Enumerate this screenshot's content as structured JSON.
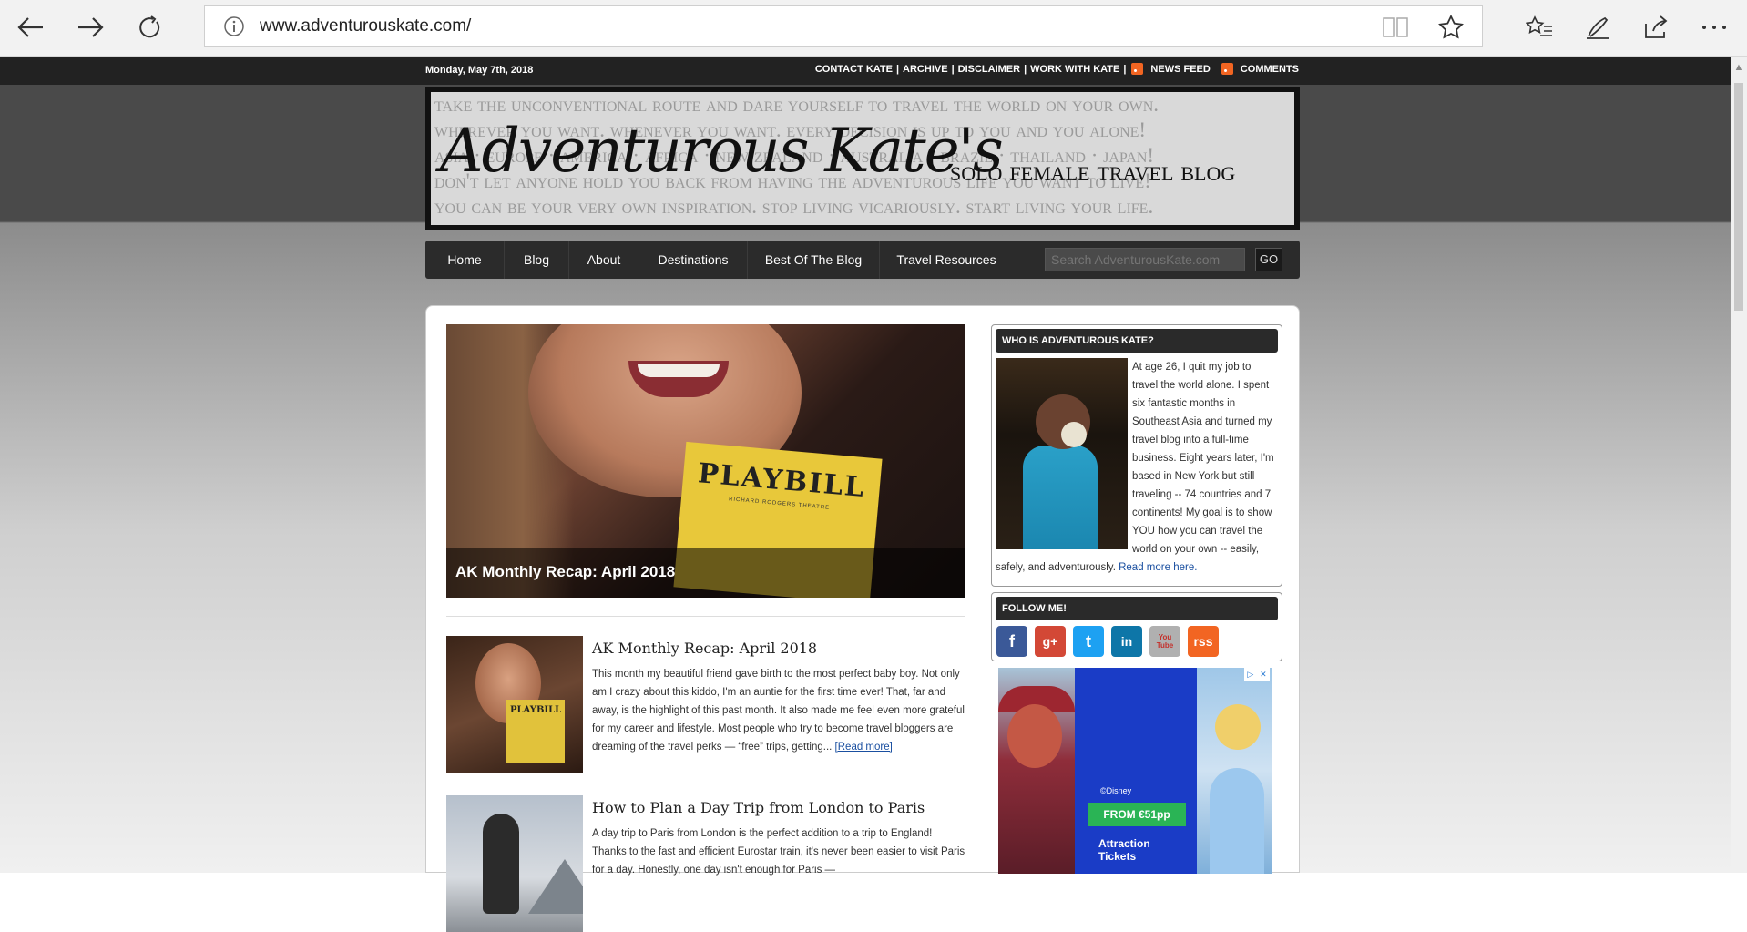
{
  "browser": {
    "url": "www.adventurouskate.com/"
  },
  "topbar": {
    "date": "Monday, May 7th, 2018",
    "links": [
      "CONTACT KATE",
      "|",
      "ARCHIVE",
      "|",
      "DISCLAIMER",
      "|",
      "WORK WITH KATE",
      "|"
    ],
    "news_feed": "NEWS FEED",
    "comments": "COMMENTS"
  },
  "banner": {
    "background_lines": [
      "take the unconventional route and dare yourself to travel the world on your own.",
      "wherever you want. whenever you want. every decision is up to you and you alone!",
      "asia · europe · america · africa · new zealand · australia · brazil · thailand · japan!",
      "don't let anyone hold you back from having the adventurous life you want to live!",
      "you can be your very own inspiration. stop living vicariously. start living your life."
    ],
    "title": "Adventurous Kate's",
    "subtitle": "solo female travel blog"
  },
  "nav": {
    "items": [
      "Home",
      "Blog",
      "About",
      "Destinations",
      "Best Of The Blog",
      "Travel Resources"
    ],
    "search_placeholder": "Search AdventurousKate.com",
    "go": "GO"
  },
  "featured": {
    "caption": "AK Monthly Recap: April 2018",
    "playbill_text": "PLAYBILL",
    "playbill_sub": "RICHARD RODGERS THEATRE"
  },
  "posts": [
    {
      "title": "AK Monthly Recap: April 2018",
      "excerpt": "This month my beautiful friend gave birth to the most perfect baby boy. Not only am I crazy about this kiddo, I'm an auntie for the first time ever! That, far and away, is the highlight of this past month. It also made me feel even more grateful for my career and lifestyle. Most people who try to become travel bloggers are dreaming of the travel perks — “free” trips, getting...",
      "more": "[Read more]",
      "thumb_text": "PLAYBILL"
    },
    {
      "title": "How to Plan a Day Trip from London to Paris",
      "excerpt": "A day trip to Paris from London is the perfect addition to a trip to England! Thanks to the fast and efficient Eurostar train, it's never been easier to visit Paris for a day. Honestly, one day isn't enough for Paris —"
    }
  ],
  "sidebar": {
    "who": {
      "heading": "WHO IS ADVENTUROUS KATE?",
      "text": "At age 26, I quit my job to travel the world alone. I spent six fantastic months in Southeast Asia and turned my travel blog into a full-time business. Eight years later, I'm based in New York but still traveling -- 74 countries and 7 continents! My goal is to show YOU how you can travel the world on your own -- easily, safely, and adventurously.",
      "link": "Read more here."
    },
    "follow": {
      "heading": "FOLLOW ME!",
      "icons": [
        {
          "name": "facebook-icon",
          "glyph": "f",
          "color": "#3b5998"
        },
        {
          "name": "google-plus-icon",
          "glyph": "g+",
          "color": "#d34836"
        },
        {
          "name": "twitter-icon",
          "glyph": "t",
          "color": "#1da1f2"
        },
        {
          "name": "linkedin-icon",
          "glyph": "in",
          "color": "#0e76a8"
        },
        {
          "name": "youtube-icon",
          "glyph": "You Tube",
          "color": "#b0b0b0"
        },
        {
          "name": "rss-icon",
          "glyph": "rss",
          "color": "#f26522"
        }
      ]
    },
    "ad": {
      "copyright": "©Disney",
      "price": "FROM €51pp",
      "brand_line1": "Attraction",
      "brand_line2": "Tickets"
    }
  }
}
